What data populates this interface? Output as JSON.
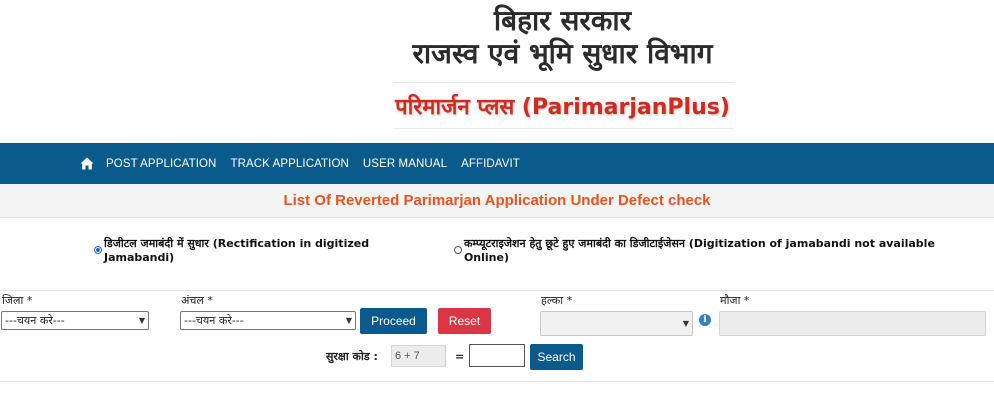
{
  "header": {
    "line1": "बिहार सरकार",
    "line2": "राजस्व एवं भूमि सुधार विभाग",
    "line3": "परिमार्जन प्लस (ParimarjanPlus)"
  },
  "nav": {
    "home_icon": "home-icon",
    "items": [
      "POST APPLICATION",
      "TRACK APPLICATION",
      "USER MANUAL",
      "AFFIDAVIT"
    ]
  },
  "page": {
    "subtitle": "List Of Reverted Parimarjan Application Under Defect check"
  },
  "radios": [
    {
      "label": "डिजीटल जमाबंदी में सुधार (Rectification in digitized Jamabandi)",
      "checked": true
    },
    {
      "label": "कम्प्यूटराइजेशन हेतु छूटे हुए जमाबंदी का डिजीटाईजेसन (Digitization of jamabandi not available Online)",
      "checked": false
    }
  ],
  "form": {
    "district_label": "जिला *",
    "district_value": "---चयन करे---",
    "circle_label": "अंचल *",
    "circle_value": "---चयन करे---",
    "proceed_label": "Proceed",
    "reset_label": "Reset",
    "halka_label": "हल्का *",
    "halka_value": "",
    "mauja_label": "मौजा *",
    "info_icon": "info-icon",
    "captcha_label": "सुरक्षा कोड :",
    "captcha_value": "6 + 7",
    "equals": "=",
    "captcha_answer": "",
    "search_label": "Search"
  },
  "colors": {
    "nav_bg": "#0b5a8c",
    "subtitle": "#e8531f",
    "header_red": "#d32a1f",
    "reset": "#dc3545"
  }
}
